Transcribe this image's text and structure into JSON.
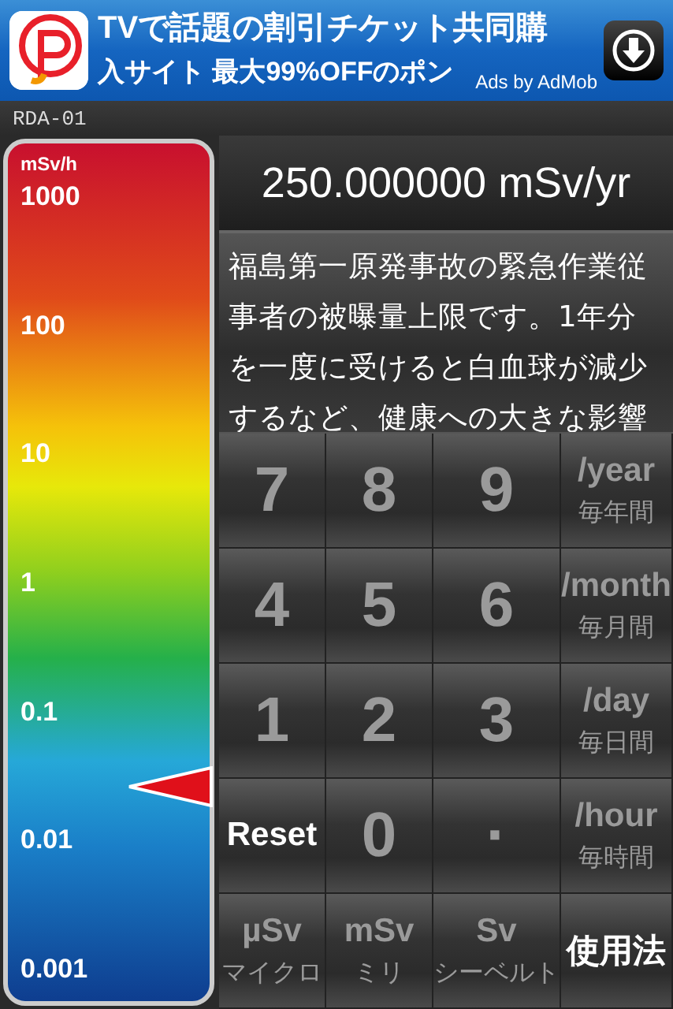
{
  "ad": {
    "headline": "TVで話題の割引チケット共同購",
    "subline": "入サイト 最大99%OFFのポン",
    "attribution": "Ads by AdMob"
  },
  "device": {
    "label": "RDA-01"
  },
  "scale": {
    "unit": "mSv/h",
    "ticks": [
      "1000",
      "100",
      "10",
      "1",
      "0.1",
      "0.01",
      "0.001"
    ]
  },
  "display": {
    "reading": "250.000000 mSv/yr"
  },
  "description": "福島第一原発事故の緊急作業従事者の被曝量上限です。1年分を一度に受けると白血球が減少するなど、健康への大きな影響",
  "keys": [
    {
      "label": "7",
      "kind": "digit"
    },
    {
      "label": "8",
      "kind": "digit"
    },
    {
      "label": "9",
      "kind": "digit"
    },
    {
      "label": "/year",
      "sub": "毎年間",
      "kind": "unit"
    },
    {
      "label": "4",
      "kind": "digit"
    },
    {
      "label": "5",
      "kind": "digit"
    },
    {
      "label": "6",
      "kind": "digit"
    },
    {
      "label": "/month",
      "sub": "毎月間",
      "kind": "unit"
    },
    {
      "label": "1",
      "kind": "digit"
    },
    {
      "label": "2",
      "kind": "digit"
    },
    {
      "label": "3",
      "kind": "digit"
    },
    {
      "label": "/day",
      "sub": "毎日間",
      "kind": "unit"
    },
    {
      "label": "Reset",
      "kind": "action"
    },
    {
      "label": "0",
      "kind": "digit"
    },
    {
      "label": "·",
      "kind": "digit"
    },
    {
      "label": "/hour",
      "sub": "毎時間",
      "kind": "unit"
    },
    {
      "label": "µSv",
      "sub": "マイクロ",
      "kind": "unit"
    },
    {
      "label": "mSv",
      "sub": "ミリ",
      "kind": "unit"
    },
    {
      "label": "Sv",
      "sub": "シーベルト",
      "kind": "unit"
    },
    {
      "label": "使用法",
      "kind": "action"
    }
  ]
}
